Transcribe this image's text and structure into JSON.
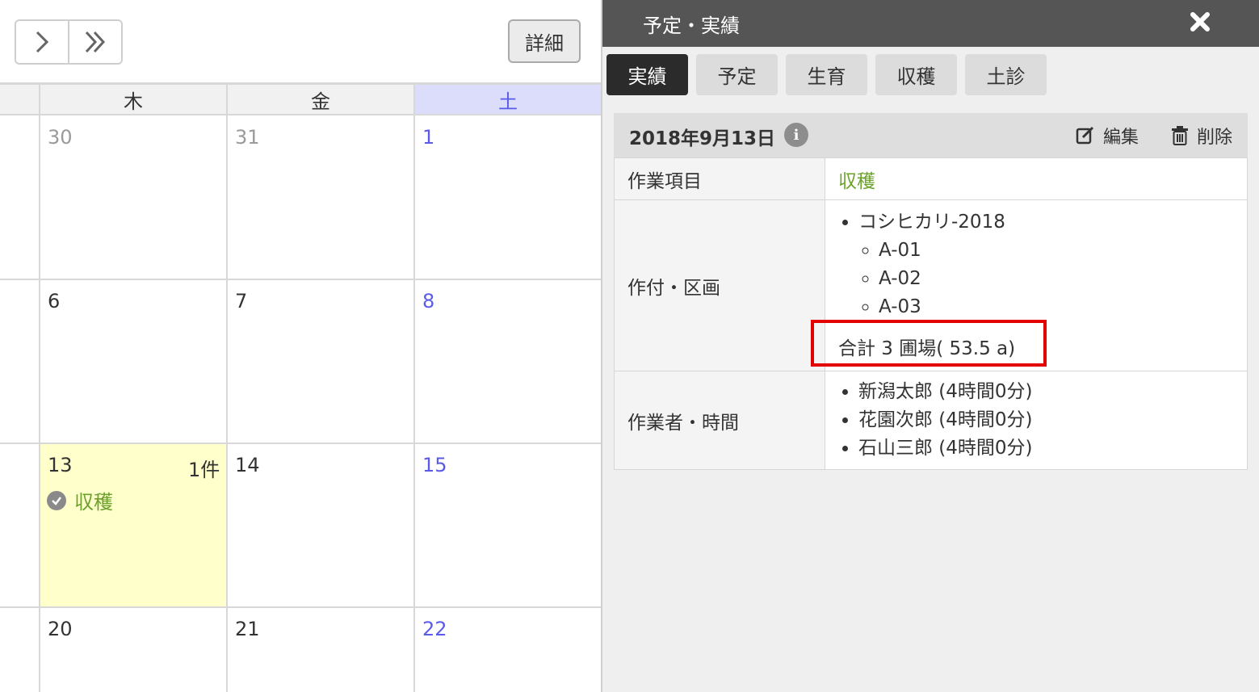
{
  "toolbar": {
    "detail_label": "詳細"
  },
  "calendar": {
    "headers": [
      {
        "label": "木"
      },
      {
        "label": "金"
      },
      {
        "label": "土"
      }
    ],
    "weeks": [
      {
        "thu": "30",
        "fri": "31",
        "sat": "1"
      },
      {
        "thu": "6",
        "fri": "7",
        "sat": "8"
      },
      {
        "thu": "13",
        "fri": "14",
        "sat": "15",
        "count": "1件",
        "event": "収穫"
      },
      {
        "thu": "20",
        "fri": "21",
        "sat": "22"
      }
    ]
  },
  "panel": {
    "title": "予定・実績",
    "tabs": [
      {
        "label": "実績",
        "active": true
      },
      {
        "label": "予定"
      },
      {
        "label": "生育"
      },
      {
        "label": "収穫"
      },
      {
        "label": "土診"
      }
    ],
    "date": "2018年9月13日",
    "edit_label": "編集",
    "delete_label": "削除",
    "rows": {
      "task": {
        "label": "作業項目",
        "value": "収穫"
      },
      "crop": {
        "label": "作付・区画",
        "crop_name": "コシヒカリ-2018",
        "plots": [
          "A-01",
          "A-02",
          "A-03"
        ],
        "total": "合計 3 圃場( 53.5 a)"
      },
      "workers": {
        "label": "作業者・時間",
        "list": [
          "新潟太郎 (4時間0分)",
          "花園次郎 (4時間0分)",
          "石山三郎 (4時間0分)"
        ]
      }
    }
  },
  "colors": {
    "saturday": "#5b5bea",
    "harvest": "#6ca12c",
    "highlight": "#ffffcb",
    "annotation_box": "#e30000",
    "panel_header": "#555555"
  }
}
